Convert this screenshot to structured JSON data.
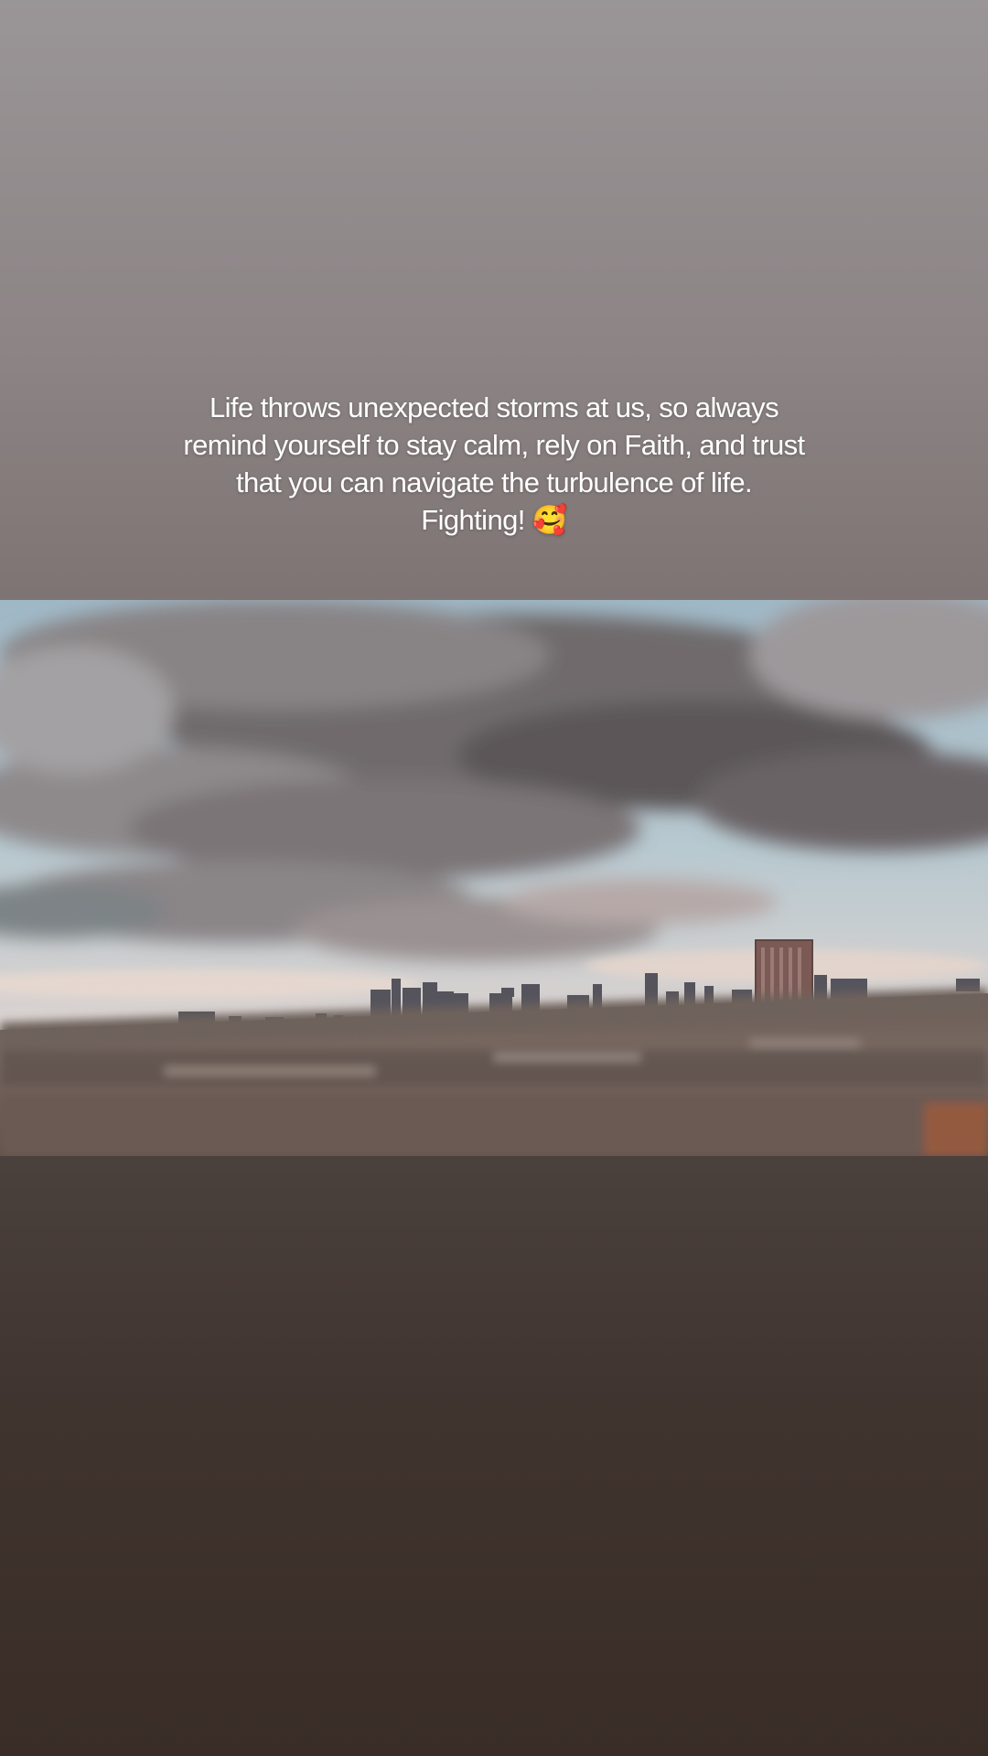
{
  "story": {
    "caption_lines": [
      "Life throws unexpected storms at us, so always",
      "remind yourself to stay calm, rely on Faith, and trust",
      "that you can navigate the turbulence of life.",
      "Fighting! 🥰"
    ],
    "photo": {
      "subject": "cloudy-sky-city-skyline-highway"
    },
    "colors": {
      "background_top": "#9a9597",
      "background_bottom": "#3a2d27",
      "caption_text": "#ffffff"
    }
  }
}
